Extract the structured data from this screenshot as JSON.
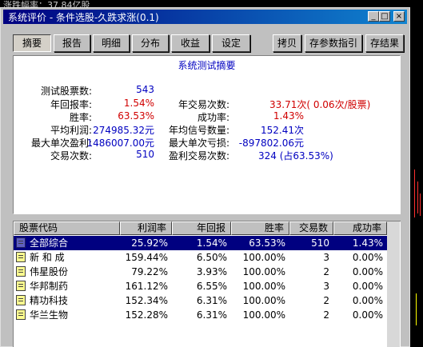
{
  "background": {
    "top_text": "涨跌幅率：37.84亿股"
  },
  "window": {
    "title": "系统评价 - 条件选股-久跌求涨(0.1)",
    "controls": {
      "minimize": "_",
      "maximize": "□",
      "close": "×"
    }
  },
  "toolbar": {
    "tabs": [
      {
        "label": "摘要",
        "active": true
      },
      {
        "label": "报告",
        "active": false
      },
      {
        "label": "明细",
        "active": false
      },
      {
        "label": "分布",
        "active": false
      },
      {
        "label": "收益",
        "active": false
      },
      {
        "label": "设定",
        "active": false
      }
    ],
    "copy": "拷贝",
    "save_guide": "存参数指引",
    "save_result": "存结果"
  },
  "summary": {
    "heading": "系统测试摘要",
    "test_count_label": "测试股票数:",
    "test_count": "543",
    "annual_return_label": "年回报率:",
    "annual_return": "1.54%",
    "win_rate_label": "胜率:",
    "win_rate": "63.53%",
    "avg_profit_label": "平均利润:",
    "avg_profit": "274985.32元",
    "max_profit_label": "最大单次盈利:",
    "max_profit": "1486007.00元",
    "trade_count_label": "交易次数:",
    "trade_count": "510",
    "annual_trades_label": "年交易次数:",
    "annual_trades": "33.71次( 0.06次/股票)",
    "success_rate_label": "成功率:",
    "success_rate": "1.43%",
    "annual_signals_label": "年均信号数量:",
    "annual_signals": "152.41次",
    "max_loss_label": "最大单次亏损:",
    "max_loss": "-897802.06元",
    "profit_trades_label": "盈利交易次数:",
    "profit_trades": "324 (占63.53%)"
  },
  "table": {
    "columns": [
      "股票代码",
      "利润率",
      "年回报",
      "胜率",
      "交易数",
      "成功率"
    ],
    "rows": [
      {
        "name": "全部综合",
        "profit": "25.92%",
        "annual": "1.54%",
        "win": "63.53%",
        "trades": "510",
        "success": "1.43%",
        "selected": true
      },
      {
        "name": "新 和 成",
        "profit": "159.44%",
        "annual": "6.50%",
        "win": "100.00%",
        "trades": "3",
        "success": "0.00%"
      },
      {
        "name": "伟星股份",
        "profit": "79.22%",
        "annual": "3.93%",
        "win": "100.00%",
        "trades": "2",
        "success": "0.00%"
      },
      {
        "name": "华邦制药",
        "profit": "161.12%",
        "annual": "6.55%",
        "win": "100.00%",
        "trades": "3",
        "success": "0.00%"
      },
      {
        "name": "精功科技",
        "profit": "152.34%",
        "annual": "6.31%",
        "win": "100.00%",
        "trades": "2",
        "success": "0.00%"
      },
      {
        "name": "华兰生物",
        "profit": "152.28%",
        "annual": "6.31%",
        "win": "100.00%",
        "trades": "2",
        "success": "0.00%"
      }
    ]
  }
}
